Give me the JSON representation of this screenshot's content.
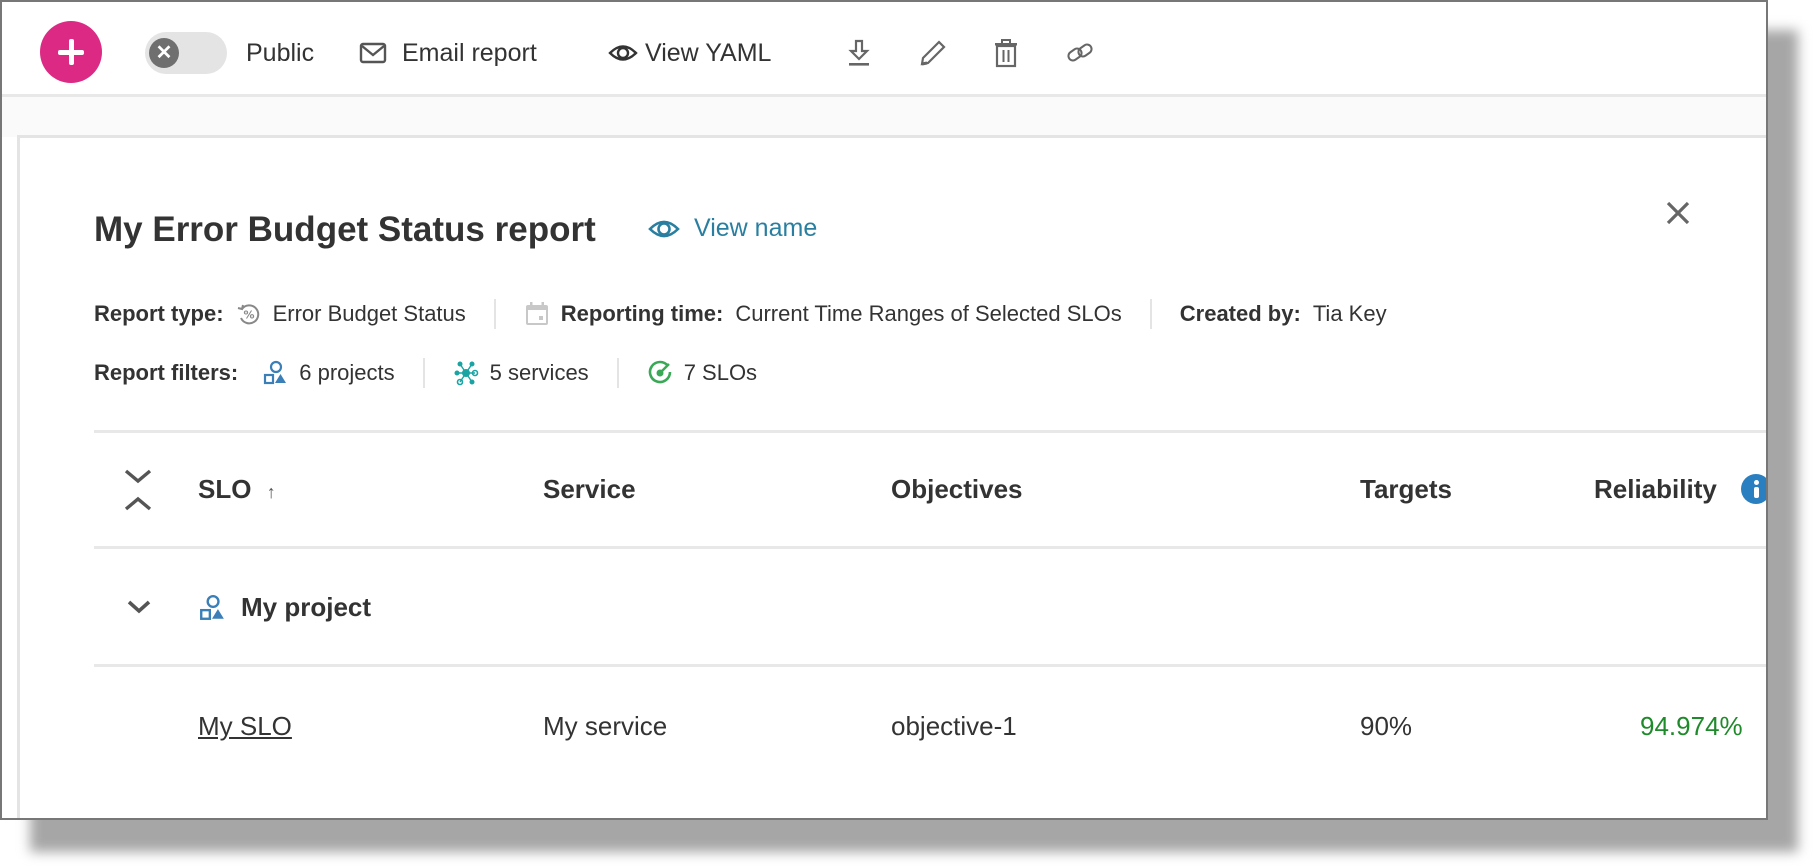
{
  "toolbar": {
    "add_button": "add",
    "public_toggle": {
      "label": "Public",
      "state": "off"
    },
    "email_report": "Email report",
    "view_yaml": "View YAML",
    "icons": [
      "download-icon",
      "pencil-icon",
      "trash-icon",
      "link-icon"
    ],
    "accent": "#dc2a84"
  },
  "report": {
    "title": "My Error Budget Status report",
    "view_name": "View name",
    "meta": {
      "report_type_label": "Report type:",
      "report_type_value": "Error Budget Status",
      "reporting_time_label": "Reporting time:",
      "reporting_time_value": "Current Time Ranges of Selected SLOs",
      "created_by_label": "Created by:",
      "created_by_value": "Tia Key"
    },
    "filters": {
      "label": "Report filters:",
      "projects": "6 projects",
      "services": "5 services",
      "slos": "7 SLOs"
    }
  },
  "table": {
    "columns": [
      "SLO",
      "Service",
      "Objectives",
      "Targets",
      "Reliability"
    ],
    "sort_indicator": "↑",
    "groups": [
      {
        "project": "My project",
        "rows": [
          {
            "slo": "My SLO",
            "service": "My service",
            "objective": "objective-1",
            "target": "90%",
            "reliability": "94.974%"
          }
        ]
      }
    ],
    "reliability_color": "#1f8a2a"
  }
}
